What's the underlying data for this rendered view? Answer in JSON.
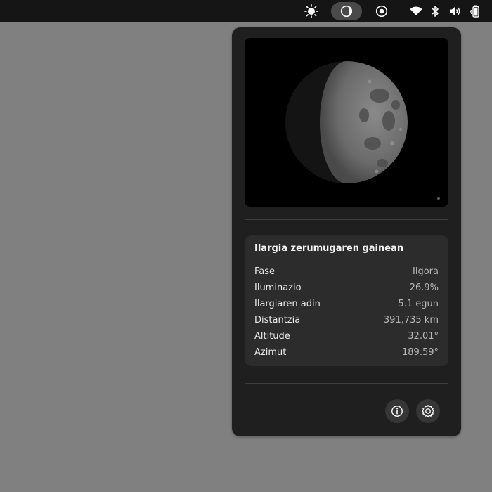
{
  "topbar": {
    "icons": [
      "sun-icon",
      "moon-phase-icon",
      "night-light-icon",
      "wifi-icon",
      "bluetooth-icon",
      "volume-icon",
      "battery-icon"
    ]
  },
  "panel": {
    "card": {
      "title": "Ilargia zerumugaren gainean",
      "rows": [
        {
          "label": "Fase",
          "value": "Ilgora"
        },
        {
          "label": "Iluminazio",
          "value": "26.9%"
        },
        {
          "label": "Ilargiaren adin",
          "value": "5.1 egun"
        },
        {
          "label": "Distantzia",
          "value": "391,735 km"
        },
        {
          "label": "Altitude",
          "value": "32.01°"
        },
        {
          "label": "Azimut",
          "value": "189.59°"
        }
      ]
    },
    "buttons": {
      "info_icon": "info-icon",
      "settings_icon": "settings-icon"
    }
  },
  "colors": {
    "desktop": "#808080",
    "topbar": "#151515",
    "panel": "#1f1f1f",
    "card": "#2c2c2c"
  }
}
